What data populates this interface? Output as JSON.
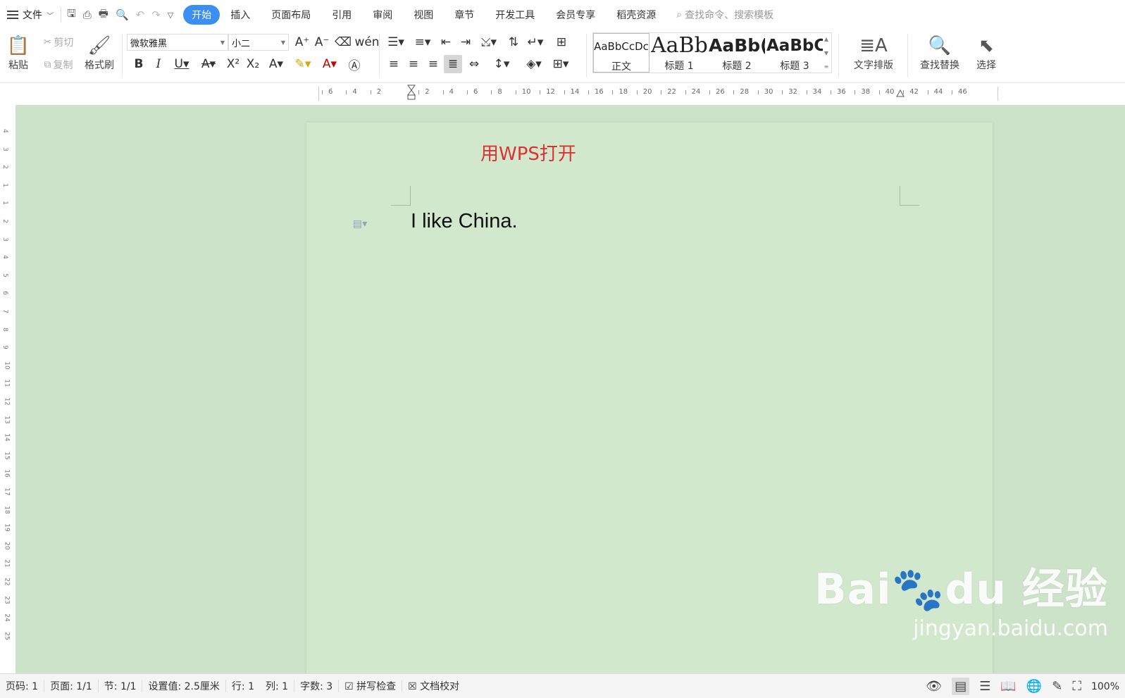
{
  "menubar": {
    "file_label": "文件",
    "tabs": [
      "开始",
      "插入",
      "页面布局",
      "引用",
      "审阅",
      "视图",
      "章节",
      "开发工具",
      "会员专享",
      "稻壳资源"
    ],
    "active_tab": "开始",
    "search_placeholder": "查找命令、搜索模板"
  },
  "ribbon": {
    "paste": "粘贴",
    "cut": "剪切",
    "copy": "复制",
    "format_painter": "格式刷",
    "font_name": "微软雅黑",
    "font_size": "小二",
    "styles": {
      "normal": {
        "sample": "AaBbCcDc",
        "name": "正文"
      },
      "h1": {
        "sample": "AaBb",
        "name": "标题 1"
      },
      "h2": {
        "sample": "AaBb(",
        "name": "标题 2"
      },
      "h3": {
        "sample": "AaBbC",
        "name": "标题 3"
      }
    },
    "text_layout": "文字排版",
    "find_replace": "查找替换",
    "select": "选择"
  },
  "ruler": {
    "ticks": [
      "6",
      "4",
      "2",
      "2",
      "4",
      "6",
      "8",
      "10",
      "12",
      "14",
      "16",
      "18",
      "20",
      "22",
      "24",
      "26",
      "28",
      "30",
      "32",
      "34",
      "36",
      "38",
      "40",
      "42",
      "44",
      "46"
    ],
    "vticks": [
      "4",
      "3",
      "2",
      "1",
      "1",
      "2",
      "3",
      "4",
      "5",
      "6",
      "7",
      "8",
      "9",
      "10",
      "11",
      "12",
      "13",
      "14",
      "15",
      "16",
      "17",
      "18",
      "19",
      "20",
      "21",
      "22",
      "23",
      "24",
      "25"
    ]
  },
  "document": {
    "annotation": "用WPS打开",
    "body_text": "I like China."
  },
  "watermark": {
    "brand": "Bai🐾du 经验",
    "url": "jingyan.baidu.com"
  },
  "statusbar": {
    "page_code": "页码: 1",
    "pages": "页面: 1/1",
    "section": "节: 1/1",
    "setting": "设置值: 2.5厘米",
    "row": "行: 1",
    "col": "列: 1",
    "word_count": "字数: 3",
    "spell_check": "拼写检查",
    "doc_proof": "文档校对",
    "zoom": "100%"
  },
  "colors": {
    "accent": "#3a8ff0",
    "canvas": "#cde3c9",
    "page": "#d1e8cd",
    "annotation": "#e03030"
  }
}
